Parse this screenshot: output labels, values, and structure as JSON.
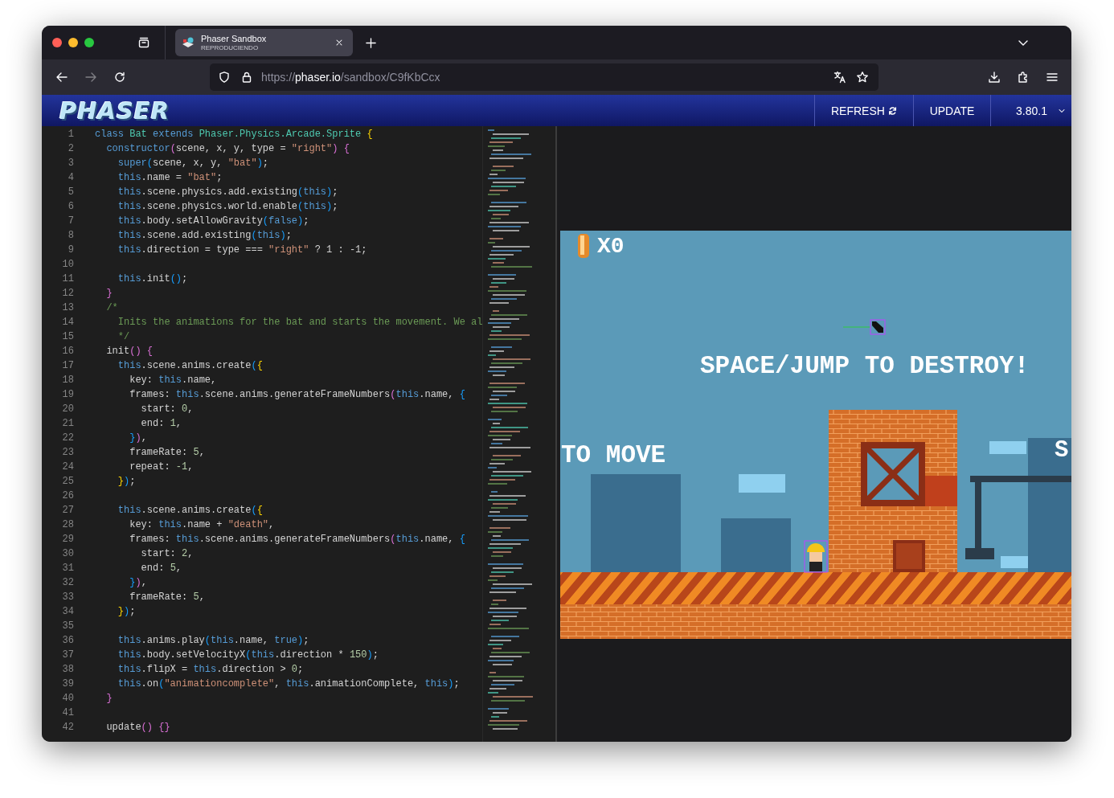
{
  "window": {
    "tabs": [
      {
        "title": "Phaser Sandbox",
        "subtitle": "REPRODUCIENDO",
        "selected": true
      }
    ],
    "navigation": {
      "back_disabled": false,
      "forward_disabled": true
    },
    "address_bar": {
      "scheme": "https://",
      "domain": "phaser.io",
      "path": "/sandbox/C9fKbCcx"
    }
  },
  "header": {
    "logo": "PHASER",
    "buttons": [
      {
        "label": "REFRESH",
        "kind": "refresh"
      },
      {
        "label": "UPDATE",
        "kind": "plain"
      }
    ],
    "version_select": {
      "value": "3.80.1"
    }
  },
  "editor": {
    "lines": [
      {
        "number": "1",
        "segments": [
          {
            "kind": "kw",
            "text": "class "
          },
          {
            "kind": "cls",
            "text": "Bat "
          },
          {
            "kind": "kw",
            "text": "extends "
          },
          {
            "kind": "cls",
            "text": "Phaser.Physics.Arcade.Sprite "
          },
          {
            "kind": "b1",
            "text": "{"
          }
        ]
      },
      {
        "number": "2",
        "segments": [
          {
            "kind": "kw",
            "text": "  constructor"
          },
          {
            "kind": "b2",
            "text": "("
          },
          {
            "kind": "txt",
            "text": "scene, x, y, type = "
          },
          {
            "kind": "str",
            "text": "\"right\""
          },
          {
            "kind": "b2",
            "text": ")"
          },
          {
            "kind": "b2",
            "text": " {"
          }
        ]
      },
      {
        "number": "3",
        "segments": [
          {
            "kind": "kw",
            "text": "    super"
          },
          {
            "kind": "b3",
            "text": "("
          },
          {
            "kind": "txt",
            "text": "scene, x, y, "
          },
          {
            "kind": "str",
            "text": "\"bat\""
          },
          {
            "kind": "b3",
            "text": ")"
          },
          {
            "kind": "txt",
            "text": ";"
          }
        ]
      },
      {
        "number": "4",
        "segments": [
          {
            "kind": "kw",
            "text": "    this"
          },
          {
            "kind": "txt",
            "text": ".name = "
          },
          {
            "kind": "str",
            "text": "\"bat\""
          },
          {
            "kind": "txt",
            "text": ";"
          }
        ]
      },
      {
        "number": "5",
        "segments": [
          {
            "kind": "kw",
            "text": "    this"
          },
          {
            "kind": "txt",
            "text": ".scene.physics.add.existing"
          },
          {
            "kind": "b3",
            "text": "("
          },
          {
            "kind": "kw",
            "text": "this"
          },
          {
            "kind": "b3",
            "text": ")"
          },
          {
            "kind": "txt",
            "text": ";"
          }
        ]
      },
      {
        "number": "6",
        "segments": [
          {
            "kind": "kw",
            "text": "    this"
          },
          {
            "kind": "txt",
            "text": ".scene.physics.world.enable"
          },
          {
            "kind": "b3",
            "text": "("
          },
          {
            "kind": "kw",
            "text": "this"
          },
          {
            "kind": "b3",
            "text": ")"
          },
          {
            "kind": "txt",
            "text": ";"
          }
        ]
      },
      {
        "number": "7",
        "segments": [
          {
            "kind": "kw",
            "text": "    this"
          },
          {
            "kind": "txt",
            "text": ".body.setAllowGravity"
          },
          {
            "kind": "b3",
            "text": "("
          },
          {
            "kind": "kw",
            "text": "false"
          },
          {
            "kind": "b3",
            "text": ")"
          },
          {
            "kind": "txt",
            "text": ";"
          }
        ]
      },
      {
        "number": "8",
        "segments": [
          {
            "kind": "kw",
            "text": "    this"
          },
          {
            "kind": "txt",
            "text": ".scene.add.existing"
          },
          {
            "kind": "b3",
            "text": "("
          },
          {
            "kind": "kw",
            "text": "this"
          },
          {
            "kind": "b3",
            "text": ")"
          },
          {
            "kind": "txt",
            "text": ";"
          }
        ]
      },
      {
        "number": "9",
        "segments": [
          {
            "kind": "kw",
            "text": "    this"
          },
          {
            "kind": "txt",
            "text": ".direction = type === "
          },
          {
            "kind": "str",
            "text": "\"right\""
          },
          {
            "kind": "txt",
            "text": " ? 1 : -1;"
          }
        ]
      },
      {
        "number": "10"
      },
      {
        "number": "11",
        "segments": [
          {
            "kind": "kw",
            "text": "    this"
          },
          {
            "kind": "txt",
            "text": ".init"
          },
          {
            "kind": "b3",
            "text": "()"
          },
          {
            "kind": "txt",
            "text": ";"
          }
        ]
      },
      {
        "number": "12",
        "segments": [
          {
            "kind": "b2",
            "text": "  }"
          }
        ]
      },
      {
        "number": "13",
        "segments": [
          {
            "kind": "cmt",
            "text": "  /*"
          }
        ]
      },
      {
        "number": "14",
        "segments": [
          {
            "kind": "cmt",
            "text": "    Inits the animations for the bat and starts the movement. We al"
          }
        ]
      },
      {
        "number": "15",
        "segments": [
          {
            "kind": "cmt",
            "text": "    */"
          }
        ]
      },
      {
        "number": "16",
        "segments": [
          {
            "kind": "txt",
            "text": "  init"
          },
          {
            "kind": "b2",
            "text": "()"
          },
          {
            "kind": "b2",
            "text": " {"
          }
        ]
      },
      {
        "number": "17",
        "segments": [
          {
            "kind": "kw",
            "text": "    this"
          },
          {
            "kind": "txt",
            "text": ".scene.anims.create"
          },
          {
            "kind": "b3",
            "text": "("
          },
          {
            "kind": "b1",
            "text": "{"
          }
        ]
      },
      {
        "number": "18",
        "segments": [
          {
            "kind": "txt",
            "text": "      key: "
          },
          {
            "kind": "kw",
            "text": "this"
          },
          {
            "kind": "txt",
            "text": ".name,"
          }
        ]
      },
      {
        "number": "19",
        "segments": [
          {
            "kind": "txt",
            "text": "      frames: "
          },
          {
            "kind": "kw",
            "text": "this"
          },
          {
            "kind": "txt",
            "text": ".scene.anims.generateFrameNumbers"
          },
          {
            "kind": "b2",
            "text": "("
          },
          {
            "kind": "kw",
            "text": "this"
          },
          {
            "kind": "txt",
            "text": ".name, "
          },
          {
            "kind": "b3",
            "text": "{"
          }
        ]
      },
      {
        "number": "20",
        "segments": [
          {
            "kind": "txt",
            "text": "        start: "
          },
          {
            "kind": "num",
            "text": "0"
          },
          {
            "kind": "txt",
            "text": ","
          }
        ]
      },
      {
        "number": "21",
        "segments": [
          {
            "kind": "txt",
            "text": "        end: "
          },
          {
            "kind": "num",
            "text": "1"
          },
          {
            "kind": "txt",
            "text": ","
          }
        ]
      },
      {
        "number": "22",
        "segments": [
          {
            "kind": "b3",
            "text": "      }"
          },
          {
            "kind": "b2",
            "text": ")"
          },
          {
            "kind": "txt",
            "text": ","
          }
        ]
      },
      {
        "number": "23",
        "segments": [
          {
            "kind": "txt",
            "text": "      frameRate: "
          },
          {
            "kind": "num",
            "text": "5"
          },
          {
            "kind": "txt",
            "text": ","
          }
        ]
      },
      {
        "number": "24",
        "segments": [
          {
            "kind": "txt",
            "text": "      repeat: "
          },
          {
            "kind": "num",
            "text": "-1"
          },
          {
            "kind": "txt",
            "text": ","
          }
        ]
      },
      {
        "number": "25",
        "segments": [
          {
            "kind": "b1",
            "text": "    }"
          },
          {
            "kind": "b3",
            "text": ")"
          },
          {
            "kind": "txt",
            "text": ";"
          }
        ]
      },
      {
        "number": "26"
      },
      {
        "number": "27",
        "segments": [
          {
            "kind": "kw",
            "text": "    this"
          },
          {
            "kind": "txt",
            "text": ".scene.anims.create"
          },
          {
            "kind": "b3",
            "text": "("
          },
          {
            "kind": "b1",
            "text": "{"
          }
        ]
      },
      {
        "number": "28",
        "segments": [
          {
            "kind": "txt",
            "text": "      key: "
          },
          {
            "kind": "kw",
            "text": "this"
          },
          {
            "kind": "txt",
            "text": ".name + "
          },
          {
            "kind": "str",
            "text": "\"death\""
          },
          {
            "kind": "txt",
            "text": ","
          }
        ]
      },
      {
        "number": "29",
        "segments": [
          {
            "kind": "txt",
            "text": "      frames: "
          },
          {
            "kind": "kw",
            "text": "this"
          },
          {
            "kind": "txt",
            "text": ".scene.anims.generateFrameNumbers"
          },
          {
            "kind": "b2",
            "text": "("
          },
          {
            "kind": "kw",
            "text": "this"
          },
          {
            "kind": "txt",
            "text": ".name, "
          },
          {
            "kind": "b3",
            "text": "{"
          }
        ]
      },
      {
        "number": "30",
        "segments": [
          {
            "kind": "txt",
            "text": "        start: "
          },
          {
            "kind": "num",
            "text": "2"
          },
          {
            "kind": "txt",
            "text": ","
          }
        ]
      },
      {
        "number": "31",
        "segments": [
          {
            "kind": "txt",
            "text": "        end: "
          },
          {
            "kind": "num",
            "text": "5"
          },
          {
            "kind": "txt",
            "text": ","
          }
        ]
      },
      {
        "number": "32",
        "segments": [
          {
            "kind": "b3",
            "text": "      }"
          },
          {
            "kind": "b2",
            "text": ")"
          },
          {
            "kind": "txt",
            "text": ","
          }
        ]
      },
      {
        "number": "33",
        "segments": [
          {
            "kind": "txt",
            "text": "      frameRate: "
          },
          {
            "kind": "num",
            "text": "5"
          },
          {
            "kind": "txt",
            "text": ","
          }
        ]
      },
      {
        "number": "34",
        "segments": [
          {
            "kind": "b1",
            "text": "    }"
          },
          {
            "kind": "b3",
            "text": ")"
          },
          {
            "kind": "txt",
            "text": ";"
          }
        ]
      },
      {
        "number": "35"
      },
      {
        "number": "36",
        "segments": [
          {
            "kind": "kw",
            "text": "    this"
          },
          {
            "kind": "txt",
            "text": ".anims.play"
          },
          {
            "kind": "b3",
            "text": "("
          },
          {
            "kind": "kw",
            "text": "this"
          },
          {
            "kind": "txt",
            "text": ".name, "
          },
          {
            "kind": "kw",
            "text": "true"
          },
          {
            "kind": "b3",
            "text": ")"
          },
          {
            "kind": "txt",
            "text": ";"
          }
        ]
      },
      {
        "number": "37",
        "segments": [
          {
            "kind": "kw",
            "text": "    this"
          },
          {
            "kind": "txt",
            "text": ".body.setVelocityX"
          },
          {
            "kind": "b3",
            "text": "("
          },
          {
            "kind": "kw",
            "text": "this"
          },
          {
            "kind": "txt",
            "text": ".direction * "
          },
          {
            "kind": "num",
            "text": "150"
          },
          {
            "kind": "b3",
            "text": ")"
          },
          {
            "kind": "txt",
            "text": ";"
          }
        ]
      },
      {
        "number": "38",
        "segments": [
          {
            "kind": "kw",
            "text": "    this"
          },
          {
            "kind": "txt",
            "text": ".flipX = "
          },
          {
            "kind": "kw",
            "text": "this"
          },
          {
            "kind": "txt",
            "text": ".direction > "
          },
          {
            "kind": "num",
            "text": "0"
          },
          {
            "kind": "txt",
            "text": ";"
          }
        ]
      },
      {
        "number": "39",
        "segments": [
          {
            "kind": "kw",
            "text": "    this"
          },
          {
            "kind": "txt",
            "text": ".on"
          },
          {
            "kind": "b3",
            "text": "("
          },
          {
            "kind": "str",
            "text": "\"animationcomplete\""
          },
          {
            "kind": "txt",
            "text": ", "
          },
          {
            "kind": "kw",
            "text": "this"
          },
          {
            "kind": "txt",
            "text": ".animationComplete, "
          },
          {
            "kind": "kw",
            "text": "this"
          },
          {
            "kind": "b3",
            "text": ")"
          },
          {
            "kind": "txt",
            "text": ";"
          }
        ]
      },
      {
        "number": "40",
        "segments": [
          {
            "kind": "b2",
            "text": "  }"
          }
        ]
      },
      {
        "number": "41"
      },
      {
        "number": "42",
        "segments": [
          {
            "kind": "txt",
            "text": "  update"
          },
          {
            "kind": "b2",
            "text": "() {}"
          }
        ]
      }
    ]
  },
  "game": {
    "counter": "X0",
    "center_message": "SPACE/JUMP TO DESTROY!",
    "left_message": "TO MOVE",
    "right_message": "S"
  }
}
